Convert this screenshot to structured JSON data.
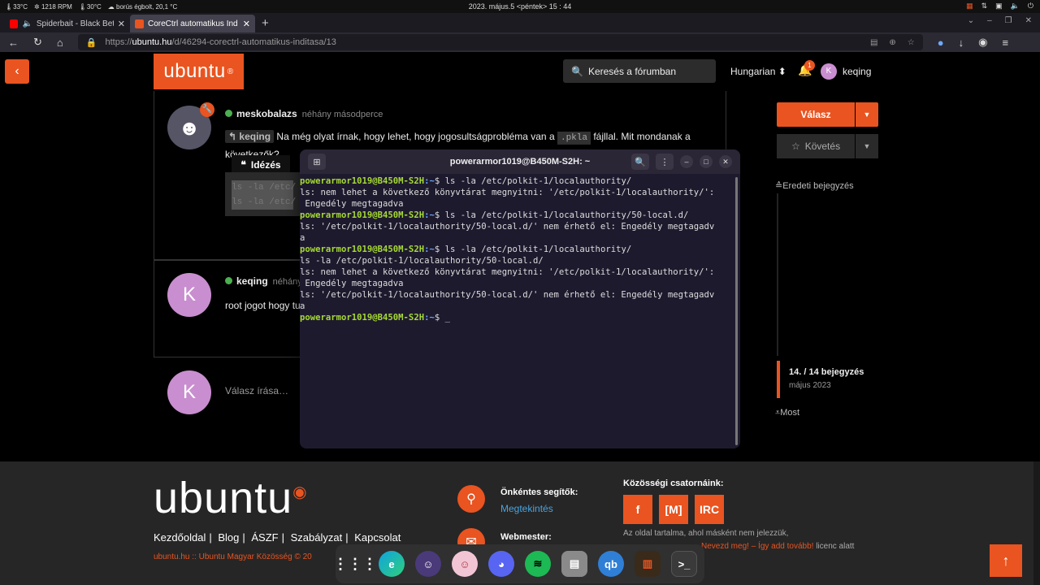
{
  "sysbar": {
    "temp_cpu": "33°C",
    "fan": "1218 RPM",
    "temp_gpu": "30°C",
    "weather": "borús égbolt, 20,1 °C",
    "datetime": "2023. május.5 <péntek> 15 : 44"
  },
  "tabs": [
    {
      "label": "Spiderbait - Black Betty",
      "favicon_color": "#ff0000"
    },
    {
      "label": "CoreCtrl automatikus Ind",
      "favicon_color": "#e95420"
    }
  ],
  "url": {
    "prefix": "https://",
    "host": "ubuntu.hu",
    "path": "/d/46294-corectrl-automatikus-inditasa/13"
  },
  "header": {
    "logo": "ubuntu",
    "search_placeholder": "Keresés a fórumban",
    "language": "Hungarian",
    "notif_count": "1",
    "avatar_letter": "K",
    "username": "keqing"
  },
  "post1": {
    "author": "meskobalazs",
    "time": "néhány másodperce",
    "quote_user": "keqing",
    "text_before": "Na még olyat írnak, hogy lehet, hogy jogosultságprobléma van a",
    "code": ".pkla",
    "text_after": "fájllal. Mit mondanak a",
    "text_line2": "következők?",
    "quote_btn": "Idézés",
    "code_lines": [
      "ls -la /etc/",
      "ls -la /etc/"
    ]
  },
  "post2": {
    "author": "keqing",
    "time": "néhány",
    "avatar_letter": "K",
    "text": "root jogot hogy tu"
  },
  "reply": {
    "avatar_letter": "K",
    "placeholder": "Válasz írása…"
  },
  "sidebar": {
    "reply_btn": "Válasz",
    "follow_btn": "Követés",
    "original_post": "Eredeti bejegyzés",
    "count": "14. / 14 bejegyzés",
    "date": "május 2023",
    "now": "Most"
  },
  "terminal": {
    "title": "powerarmor1019@B450M-S2H: ~",
    "lines": [
      {
        "type": "prompt",
        "user": "powerarmor1019@B450M-S2H",
        "path": ":~",
        "cmd": "$ ls -la /etc/polkit-1/localauthority/"
      },
      {
        "type": "out",
        "text": "ls: nem lehet a következő könyvtárat megnyitni: '/etc/polkit-1/localauthority/':"
      },
      {
        "type": "out",
        "text": " Engedély megtagadva"
      },
      {
        "type": "prompt",
        "user": "powerarmor1019@B450M-S2H",
        "path": ":~",
        "cmd": "$ ls -la /etc/polkit-1/localauthority/50-local.d/"
      },
      {
        "type": "out",
        "text": "ls: '/etc/polkit-1/localauthority/50-local.d/' nem érhető el: Engedély megtagadv"
      },
      {
        "type": "out",
        "text": "a"
      },
      {
        "type": "prompt",
        "user": "powerarmor1019@B450M-S2H",
        "path": ":~",
        "cmd": "$ ls -la /etc/polkit-1/localauthority/"
      },
      {
        "type": "out",
        "text": "ls -la /etc/polkit-1/localauthority/50-local.d/"
      },
      {
        "type": "out",
        "text": "ls: nem lehet a következő könyvtárat megnyitni: '/etc/polkit-1/localauthority/':"
      },
      {
        "type": "out",
        "text": " Engedély megtagadva"
      },
      {
        "type": "out",
        "text": "ls: '/etc/polkit-1/localauthority/50-local.d/' nem érhető el: Engedély megtagadv"
      },
      {
        "type": "out",
        "text": "a"
      },
      {
        "type": "prompt",
        "user": "powerarmor1019@B450M-S2H",
        "path": ":~",
        "cmd": "$ _"
      }
    ]
  },
  "footer": {
    "logo": "ubuntu",
    "links": [
      "Kezdőoldal",
      "Blog",
      "ÁSZF",
      "Szabályzat",
      "Kapcsolat"
    ],
    "copyright": "ubuntu.hu :: Ubuntu Magyar Közösség © 20",
    "volunteers_title": "Önkéntes segítők:",
    "volunteers_link": "Megtekintés",
    "webmaster_title": "Webmester:",
    "social_title": "Közösségi csatornáink:",
    "social": [
      "f",
      "[M]",
      "IRC"
    ],
    "license1": "Az oldal tartalma, ahol másként nem jelezzük,",
    "license2_a": "Nevezd meg! – Így add tovább!",
    "license2_b": "licenc alatt"
  },
  "dock": [
    "apps-grid",
    "edge",
    "anime1",
    "anime2",
    "discord",
    "spotify",
    "files",
    "qbittorrent",
    "corectrl",
    "terminal"
  ]
}
